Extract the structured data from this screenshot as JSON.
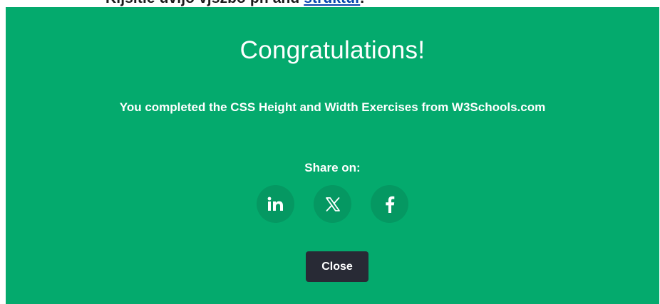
{
  "background_page": {
    "partial_text": "Kijsitie uvijo vjszbo pn and",
    "link_text": "struktur"
  },
  "modal": {
    "title": "Congratulations!",
    "message": "You completed the CSS Height and Width Exercises from W3Schools.com",
    "share_label": "Share on:",
    "share_buttons": [
      {
        "icon": "linkedin-icon",
        "glyph": "in"
      },
      {
        "icon": "x-twitter-icon",
        "glyph": "𝕏"
      },
      {
        "icon": "facebook-icon",
        "glyph": "f"
      }
    ],
    "close_label": "Close"
  },
  "colors": {
    "modal_background": "#04aa6d",
    "share_button_background": "#059862",
    "close_button_background": "#282a35",
    "text": "#ffffff"
  }
}
